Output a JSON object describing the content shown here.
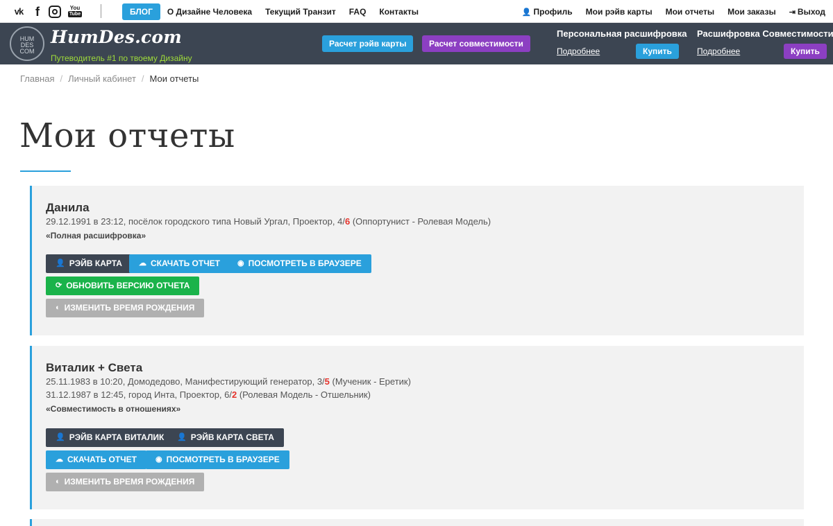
{
  "topbar": {
    "social": [
      "vk-icon",
      "facebook-icon",
      "instagram-icon",
      "youtube-icon"
    ],
    "youtube_text": "You",
    "youtube_tube": "Tube",
    "nav": [
      "БЛОГ",
      "О Дизайне Человека",
      "Текущий Транзит",
      "FAQ",
      "Контакты"
    ],
    "right_nav": [
      "Профиль",
      "Мои рэйв карты",
      "Мои отчеты",
      "Мои заказы",
      "Выход"
    ]
  },
  "header": {
    "logo_badge": [
      "HUM",
      "DES",
      "COM"
    ],
    "logo_text": "HumDes.com",
    "tagline": "Путеводитель #1 по твоему Дизайну",
    "btn_rave": "Расчет рэйв карты",
    "btn_compat": "Расчет совместимости",
    "product1": {
      "title": "Персональная расшифровка",
      "more": "Подробнее",
      "buy": "Купить"
    },
    "product2": {
      "title": "Расшифровка Совместимости",
      "more": "Подробнее",
      "buy": "Купить"
    }
  },
  "breadcrumb": {
    "home": "Главная",
    "cabinet": "Личный кабинет",
    "current": "Мои отчеты",
    "sep": "/"
  },
  "page_title": "Мои отчеты",
  "reports": [
    {
      "name": "Данила",
      "line1_pre": "29.12.1991 в 23:12, посёлок городского типа Новый Ургал, Проектор, 4/",
      "line1_red": "6",
      "line1_post": " (Оппортунист - Ролевая Модель)",
      "type": "«Полная расшифровка»",
      "btn_rave": "Рэйв карта",
      "btn_download": "Скачать отчет",
      "btn_view": "Посмотреть в браузере",
      "btn_update": "Обновить версию отчета",
      "btn_change": "Изменить время рождения"
    },
    {
      "name": "Виталик + Света",
      "line1_pre": "25.11.1983 в 10:20, Домодедово, Манифестирующий генератор, 3/",
      "line1_red": "5",
      "line1_post": " (Мученик - Еретик)",
      "line2_pre": "31.12.1987 в 12:45, город Инта, Проектор, 6/",
      "line2_red": "2",
      "line2_post": " (Ролевая Модель - Отшельник)",
      "type": "«Совместимость в отношениях»",
      "btn_rave1": "Рэйв карта Виталик",
      "btn_rave2": "Рэйв карта Света",
      "btn_download": "Скачать отчет",
      "btn_view": "Посмотреть в браузере",
      "btn_change": "Изменить время рождения"
    }
  ],
  "icons": {
    "user": "👤",
    "cloud": "☁",
    "eye": "◉",
    "refresh": "⟳",
    "toggle": "◐",
    "exit": "⇥"
  },
  "colors": {
    "accent_blue": "#2aa0dc",
    "accent_purple": "#8c3fc2",
    "header_bg": "#3c4552",
    "green": "#1ab34a",
    "red": "#e4322b"
  }
}
